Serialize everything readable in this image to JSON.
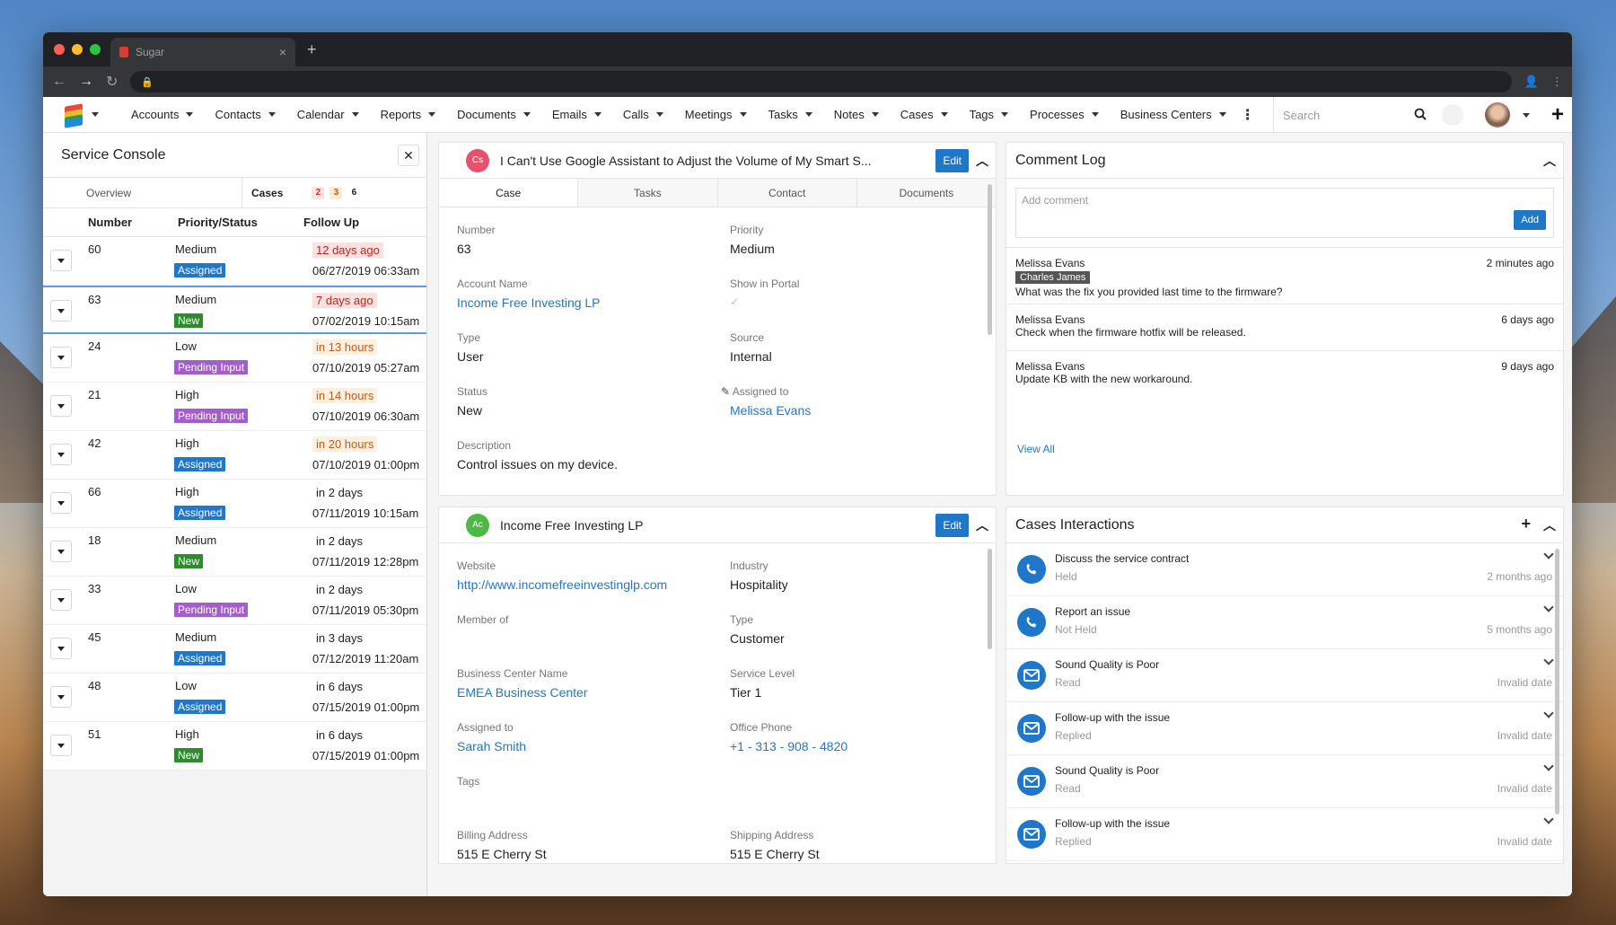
{
  "browser": {
    "tab_title": "Sugar"
  },
  "nav": {
    "menu": [
      "Accounts",
      "Contacts",
      "Calendar",
      "Reports",
      "Documents",
      "Emails",
      "Calls",
      "Meetings",
      "Tasks",
      "Notes",
      "Cases",
      "Tags",
      "Processes",
      "Business Centers"
    ],
    "search_placeholder": "Search"
  },
  "console": {
    "title": "Service Console",
    "tabs": {
      "overview": "Overview",
      "cases": "Cases",
      "count_red": "2",
      "count_orange": "3",
      "count_total": "6"
    },
    "columns": {
      "number": "Number",
      "priority_status": "Priority/Status",
      "follow_up": "Follow Up"
    },
    "rows": [
      {
        "num": "60",
        "pri": "Medium",
        "status": "Assigned",
        "fu": "12 days ago",
        "fu_style": "red",
        "date": "06/27/2019 06:33am"
      },
      {
        "num": "63",
        "pri": "Medium",
        "status": "New",
        "fu": "7 days ago",
        "fu_style": "red",
        "date": "07/02/2019 10:15am",
        "selected": true
      },
      {
        "num": "24",
        "pri": "Low",
        "status": "Pending Input",
        "fu": "in 13 hours",
        "fu_style": "orange",
        "date": "07/10/2019 05:27am"
      },
      {
        "num": "21",
        "pri": "High",
        "status": "Pending Input",
        "fu": "in 14 hours",
        "fu_style": "orange",
        "date": "07/10/2019 06:30am"
      },
      {
        "num": "42",
        "pri": "High",
        "status": "Assigned",
        "fu": "in 20 hours",
        "fu_style": "orange",
        "date": "07/10/2019 01:00pm"
      },
      {
        "num": "66",
        "pri": "High",
        "status": "Assigned",
        "fu": "in 2 days",
        "fu_style": "plain",
        "date": "07/11/2019 10:15am"
      },
      {
        "num": "18",
        "pri": "Medium",
        "status": "New",
        "fu": "in 2 days",
        "fu_style": "plain",
        "date": "07/11/2019 12:28pm"
      },
      {
        "num": "33",
        "pri": "Low",
        "status": "Pending Input",
        "fu": "in 2 days",
        "fu_style": "plain",
        "date": "07/11/2019 05:30pm"
      },
      {
        "num": "45",
        "pri": "Medium",
        "status": "Assigned",
        "fu": "in 3 days",
        "fu_style": "plain",
        "date": "07/12/2019 11:20am"
      },
      {
        "num": "48",
        "pri": "Low",
        "status": "Assigned",
        "fu": "in 6 days",
        "fu_style": "plain",
        "date": "07/15/2019 01:00pm"
      },
      {
        "num": "51",
        "pri": "High",
        "status": "New",
        "fu": "in 6 days",
        "fu_style": "plain",
        "date": "07/15/2019 01:00pm"
      }
    ]
  },
  "case": {
    "badge": "Cs",
    "title": "I Can't Use Google Assistant to Adjust the Volume of My Smart S...",
    "edit": "Edit",
    "tabs": [
      "Case",
      "Tasks",
      "Contact",
      "Documents"
    ],
    "number_label": "Number",
    "number": "63",
    "priority_label": "Priority",
    "priority": "Medium",
    "account_label": "Account Name",
    "account": "Income Free Investing LP",
    "portal_label": "Show in Portal",
    "type_label": "Type",
    "type": "User",
    "source_label": "Source",
    "source": "Internal",
    "status_label": "Status",
    "status": "New",
    "assigned_label": "Assigned to",
    "assigned": "Melissa Evans",
    "desc_label": "Description",
    "desc": "Control issues on my device."
  },
  "account": {
    "badge": "Ac",
    "title": "Income Free Investing LP",
    "edit": "Edit",
    "website_label": "Website",
    "website": "http://www.incomefreeinvestinglp.com",
    "industry_label": "Industry",
    "industry": "Hospitality",
    "member_label": "Member of",
    "type_label": "Type",
    "type": "Customer",
    "bc_label": "Business Center Name",
    "bc": "EMEA Business Center",
    "sl_label": "Service Level",
    "sl": "Tier 1",
    "assigned_label": "Assigned to",
    "assigned": "Sarah Smith",
    "phone_label": "Office Phone",
    "phone": "+1 - 313 - 908 - 4820",
    "tags_label": "Tags",
    "billing_label": "Billing Address",
    "billing": "515 E Cherry St",
    "shipping_label": "Shipping Address",
    "shipping": "515 E Cherry St"
  },
  "comment_log": {
    "title": "Comment Log",
    "placeholder": "Add comment",
    "add": "Add",
    "entries": [
      {
        "who": "Melissa Evans",
        "when": "2 minutes ago",
        "mention": "Charles James",
        "text": "What was the fix you provided last time to the firmware?"
      },
      {
        "who": "Melissa Evans",
        "when": "6 days ago",
        "text": "Check when the firmware hotfix will be released."
      },
      {
        "who": "Melissa Evans",
        "when": "9 days ago",
        "text": "Update KB with the new workaround."
      }
    ],
    "view_all": "View All"
  },
  "interactions": {
    "title": "Cases Interactions",
    "items": [
      {
        "icon": "phone-icon",
        "title": "Discuss the service contract",
        "status": "Held",
        "when": "2 months ago"
      },
      {
        "icon": "phone-icon",
        "title": "Report an issue",
        "status": "Not Held",
        "when": "5 months ago"
      },
      {
        "icon": "email-icon",
        "title": "Sound Quality is Poor",
        "status": "Read",
        "when": "Invalid date"
      },
      {
        "icon": "email-icon",
        "title": "Follow-up with the issue",
        "status": "Replied",
        "when": "Invalid date"
      },
      {
        "icon": "email-icon",
        "title": "Sound Quality is Poor",
        "status": "Read",
        "when": "Invalid date"
      },
      {
        "icon": "email-icon",
        "title": "Follow-up with the issue",
        "status": "Replied",
        "when": "Invalid date"
      }
    ]
  },
  "colors": {
    "accent": "#1f77c9",
    "assigned": "#1f77c9",
    "new": "#2e8b2e",
    "pending": "#a45ec9"
  }
}
